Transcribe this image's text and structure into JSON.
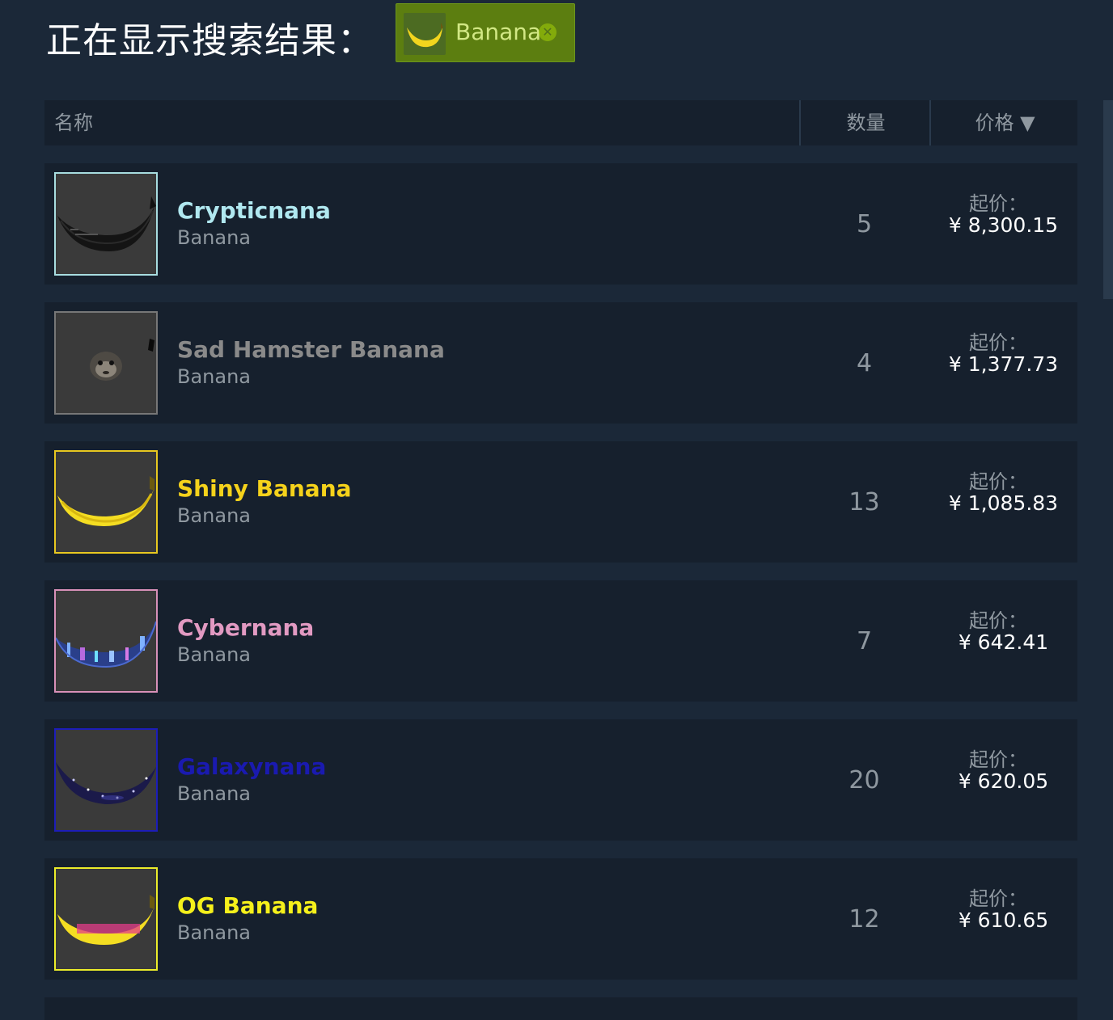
{
  "header": {
    "showing_label": "正在显示搜索结果：",
    "filter_tag": {
      "label": "Banana",
      "icon": "banana-icon",
      "close_icon": "close-circle-icon"
    }
  },
  "table": {
    "columns": {
      "name": "名称",
      "quantity": "数量",
      "price": "价格 ▼"
    }
  },
  "items": [
    {
      "name": "Crypticnana",
      "game": "Banana",
      "quantity": "5",
      "price_label": "起价：",
      "price": "¥ 8,300.15",
      "name_color": "#b0e8f0",
      "border_color": "#a8dde0",
      "icon": "crypticnana-banana-icon"
    },
    {
      "name": "Sad Hamster Banana",
      "game": "Banana",
      "quantity": "4",
      "price_label": "起价：",
      "price": "¥ 1,377.73",
      "name_color": "#8a8a8a",
      "border_color": "#777777",
      "icon": "sad-hamster-icon"
    },
    {
      "name": "Shiny Banana",
      "game": "Banana",
      "quantity": "13",
      "price_label": "起价：",
      "price": "¥ 1,085.83",
      "name_color": "#f5d21b",
      "border_color": "#e8c820",
      "icon": "shiny-banana-icon"
    },
    {
      "name": "Cybernana",
      "game": "Banana",
      "quantity": "7",
      "price_label": "起价：",
      "price": "¥ 642.41",
      "name_color": "#e29ac2",
      "border_color": "#d890b8",
      "icon": "cybernana-banana-icon"
    },
    {
      "name": "Galaxynana",
      "game": "Banana",
      "quantity": "20",
      "price_label": "起价：",
      "price": "¥ 620.05",
      "name_color": "#1a1ab0",
      "border_color": "#1d1db8",
      "icon": "galaxynana-banana-icon"
    },
    {
      "name": "OG Banana",
      "game": "Banana",
      "quantity": "12",
      "price_label": "起价：",
      "price": "¥ 610.65",
      "name_color": "#f5f01b",
      "border_color": "#ecec2a",
      "icon": "og-banana-icon"
    }
  ]
}
